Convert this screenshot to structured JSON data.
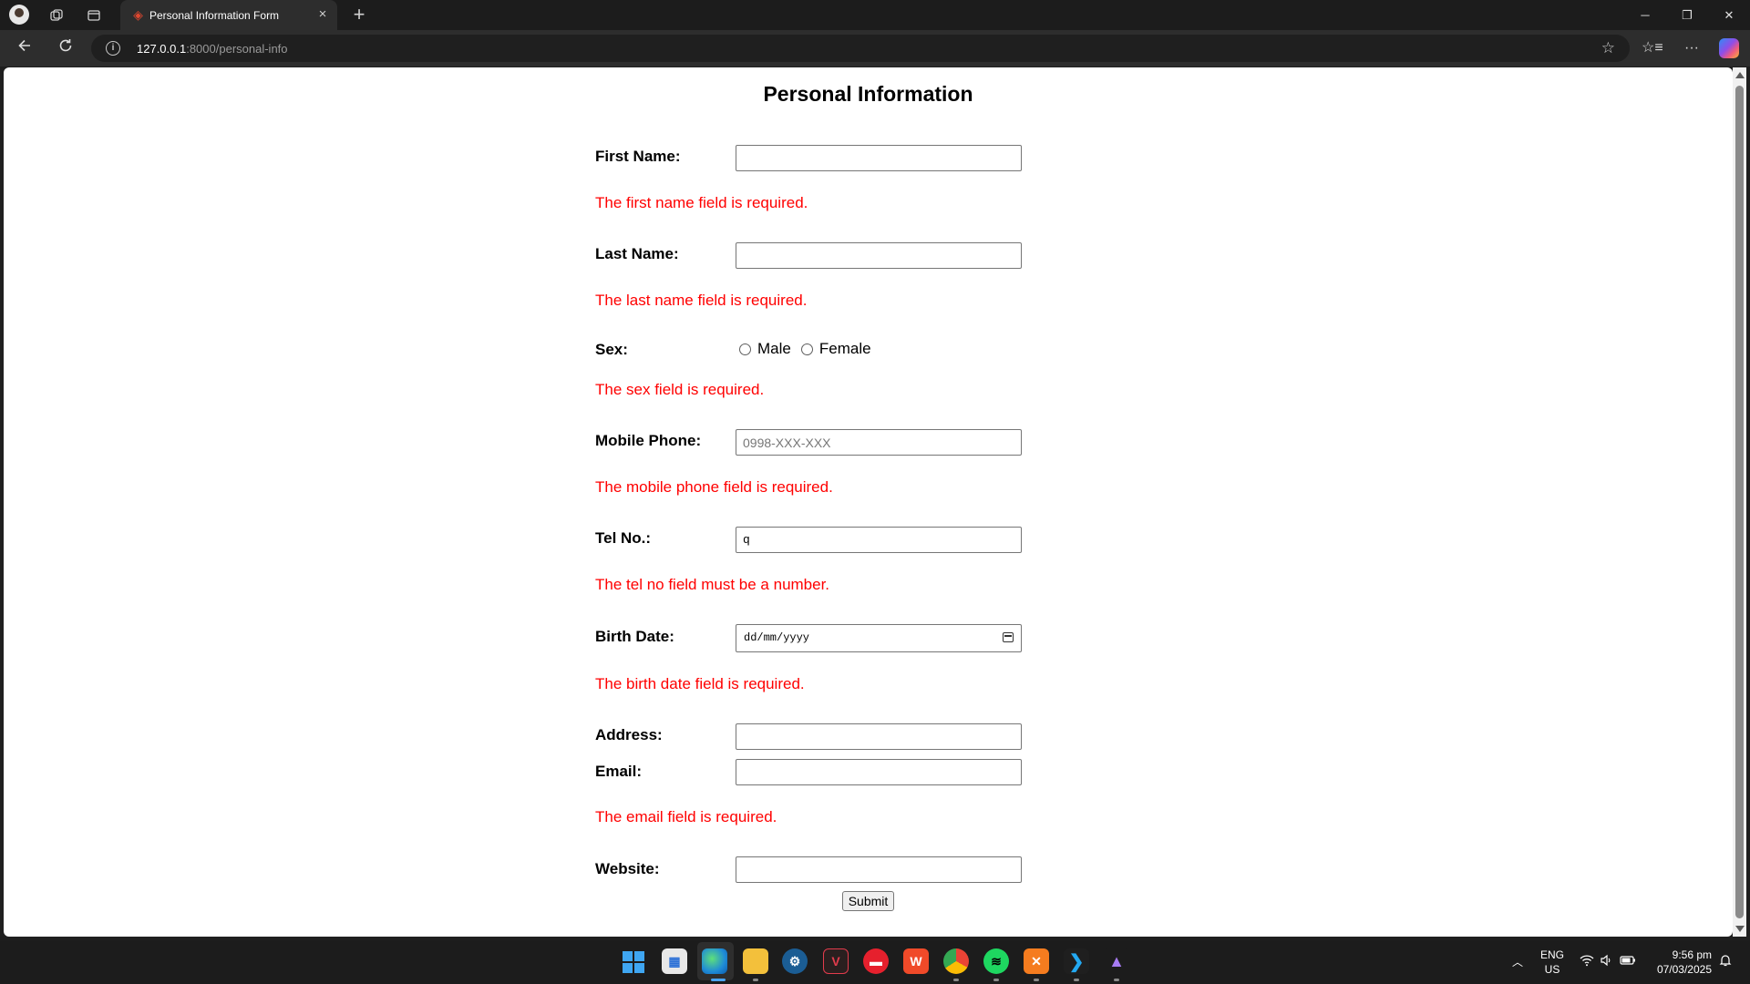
{
  "browser": {
    "tab_title": "Personal Information Form",
    "tab_close": "×",
    "new_tab": "+",
    "address_host": "127.0.0.1",
    "address_rest": ":8000/personal-info",
    "window_controls": {
      "minimize": "─",
      "restore": "❐",
      "close": "✕"
    }
  },
  "form": {
    "title": "Personal Information",
    "first_name": {
      "label": "First Name:",
      "value": "",
      "error": "The first name field is required."
    },
    "last_name": {
      "label": "Last Name:",
      "value": "",
      "error": "The last name field is required."
    },
    "sex": {
      "label": "Sex:",
      "options": [
        "Male",
        "Female"
      ],
      "selected": null,
      "error": "The sex field is required."
    },
    "mobile_phone": {
      "label": "Mobile Phone:",
      "value": "",
      "placeholder": "0998-XXX-XXX",
      "error": "The mobile phone field is required."
    },
    "tel_no": {
      "label": "Tel No.:",
      "value": "q",
      "error": "The tel no field must be a number."
    },
    "birth_date": {
      "label": "Birth Date:",
      "display": "dd/mm/yyyy",
      "error": "The birth date field is required."
    },
    "address": {
      "label": "Address:",
      "value": ""
    },
    "email": {
      "label": "Email:",
      "value": "",
      "error": "The email field is required."
    },
    "website": {
      "label": "Website:",
      "value": ""
    },
    "submit_label": "Submit"
  },
  "taskbar": {
    "pinned_apps": [
      "windows-start",
      "microsoft-store",
      "edge",
      "file-explorer",
      "steam",
      "vivaldi",
      "anydesk",
      "wps-office",
      "chrome",
      "spotify",
      "xampp",
      "vscode",
      "app-launcher"
    ],
    "active_app": "edge",
    "language": "ENG",
    "region": "US",
    "time": "9:56 pm",
    "date": "07/03/2025"
  },
  "colors": {
    "error": "#ff0000",
    "accent": "#3fa6f2"
  }
}
